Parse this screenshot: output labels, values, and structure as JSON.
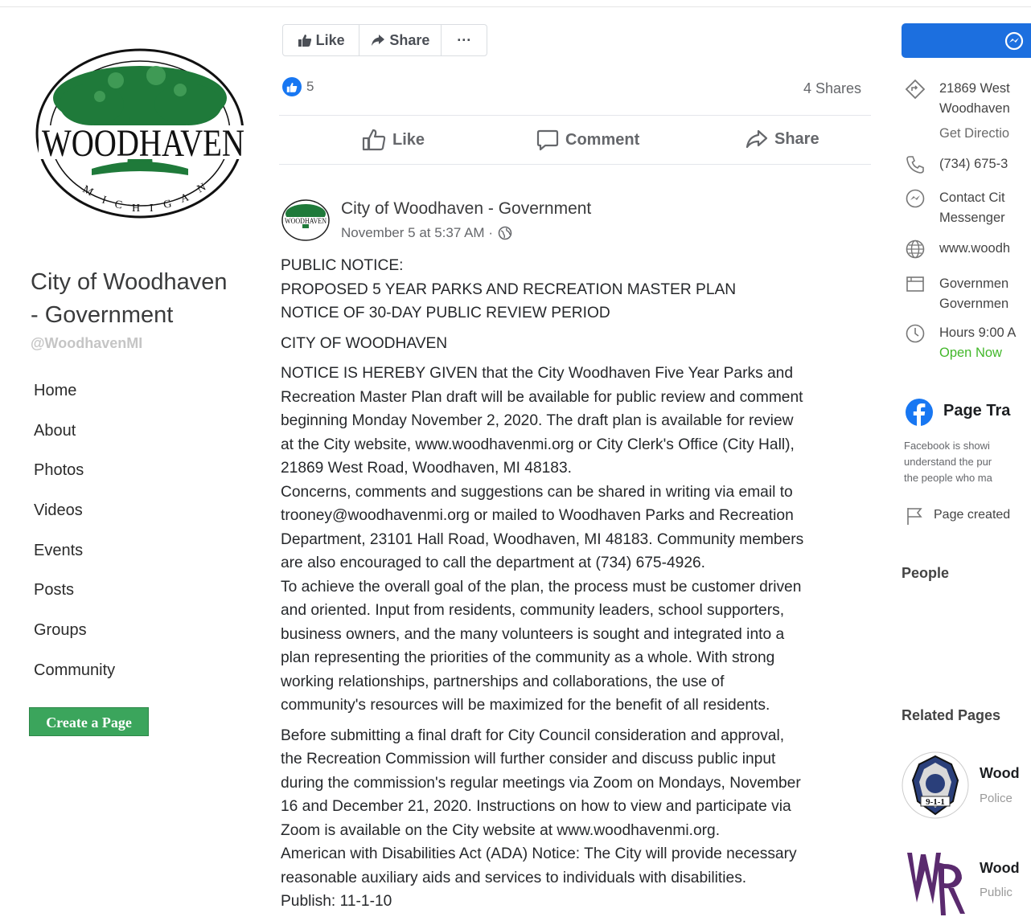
{
  "sidebar": {
    "page_title_line1": "City of Woodhaven",
    "page_title_line2": "- Government",
    "handle": "@WoodhavenMI",
    "logo": {
      "wordmark": "WOODHAVEN",
      "state": "MICHIGAN"
    },
    "nav": [
      "Home",
      "About",
      "Photos",
      "Videos",
      "Events",
      "Posts",
      "Groups",
      "Community"
    ],
    "create_page_label": "Create a Page"
  },
  "top_actions": {
    "like": "Like",
    "share": "Share",
    "more": "···"
  },
  "post_stats": {
    "reactions": "5",
    "shares": "4 Shares"
  },
  "post_actions": {
    "like": "Like",
    "comment": "Comment",
    "share": "Share"
  },
  "post": {
    "author": "City of Woodhaven - Government",
    "timestamp": "November 5 at 5:37 AM ·",
    "paragraphs": [
      "PUBLIC NOTICE:\nPROPOSED 5 YEAR PARKS AND RECREATION MASTER PLAN\nNOTICE OF 30-DAY PUBLIC REVIEW PERIOD",
      "CITY OF WOODHAVEN",
      "NOTICE IS HEREBY GIVEN that the City Woodhaven Five Year Parks and\nRecreation Master Plan draft will be available for public review and comment\nbeginning Monday November 2, 2020. The draft plan is available for review\nat the City website, www.woodhavenmi.org or City Clerk's Office (City Hall),\n21869 West Road, Woodhaven, MI 48183.\nConcerns, comments and suggestions can be shared in writing via email to\ntrooney@woodhavenmi.org or mailed to Woodhaven Parks and Recreation\nDepartment, 23101 Hall Road, Woodhaven, MI 48183. Community members\nare also encouraged to call the department at (734) 675-4926.\nTo achieve the overall goal of the plan, the process must be customer driven\nand oriented. Input from residents, community leaders, school supporters,\nbusiness owners, and the many volunteers is sought and integrated into a\nplan representing the priorities of the community as a whole. With strong\nworking relationships, partnerships and collaborations, the use of\ncommunity's resources will be maximized for the benefit of all residents.",
      "Before submitting a final draft for City Council consideration and approval,\nthe Recreation Commission will further consider and discuss public input\nduring the commission's regular meetings via Zoom on Mondays, November\n16 and December 21, 2020. Instructions on how to view and participate via\nZoom is available on the City website at www.woodhavenmi.org.\nAmerican with Disabilities Act (ADA) Notice: The City will provide necessary\nreasonable auxiliary aids and services to individuals with disabilities.\nPublish: 11-1-10"
    ]
  },
  "about": {
    "address_line1": "21869 West",
    "address_line2": "Woodhaven",
    "directions": "Get Directio",
    "phone": "(734) 675-3",
    "messenger_line1": "Contact Cit",
    "messenger_line2": "Messenger",
    "website": "www.woodh",
    "category_line1": "Governmen",
    "category_line2": "Governmen",
    "hours": "Hours 9:00 A",
    "open_now": "Open Now"
  },
  "transparency": {
    "title": "Page Tra",
    "text_line1": "Facebook is showi",
    "text_line2": "understand the pur",
    "text_line3": "the people who ma",
    "page_created": "Page created"
  },
  "people_heading": "People",
  "related": {
    "heading": "Related Pages",
    "items": [
      {
        "name": "Wood",
        "category": "Police",
        "badge": "9-1-1"
      },
      {
        "name": "Wood",
        "category": "Public"
      }
    ]
  },
  "colors": {
    "facebook_blue": "#1877f2",
    "create_green": "#3ba55c",
    "logo_green": "#1f7a3a"
  }
}
